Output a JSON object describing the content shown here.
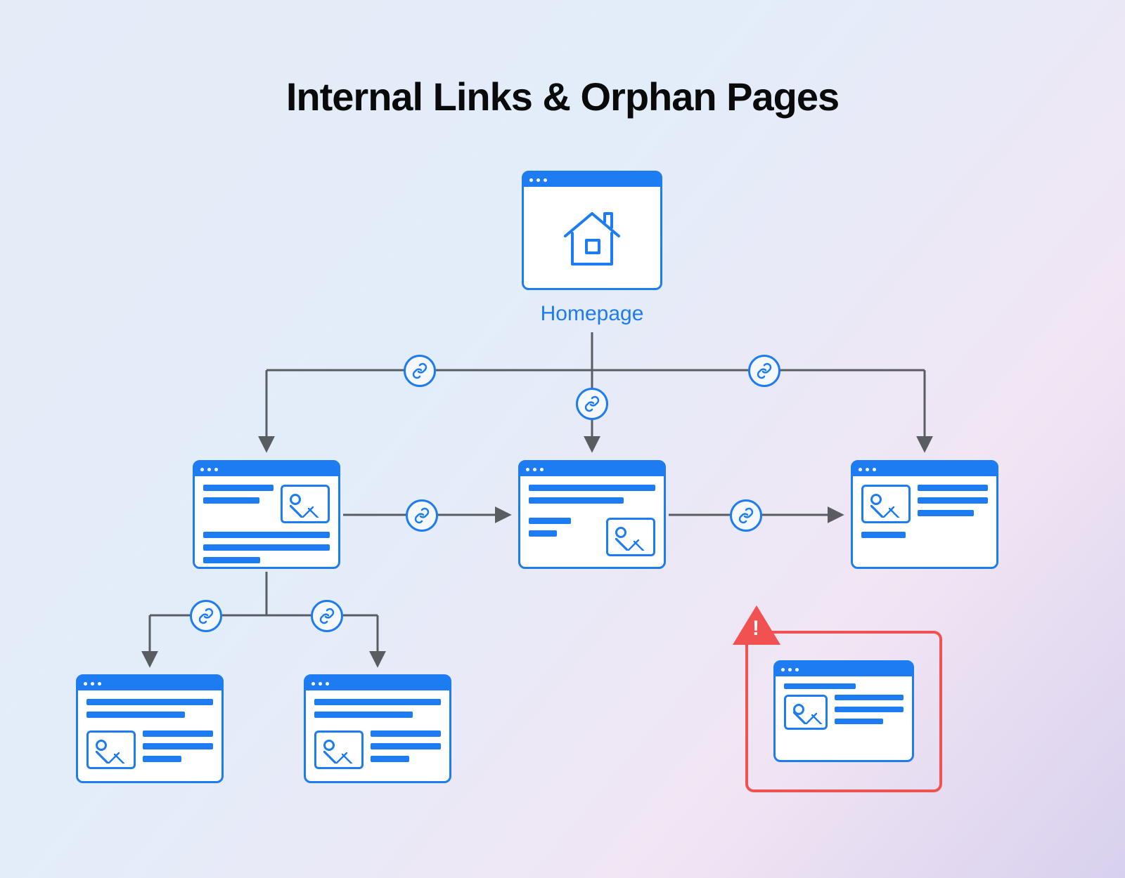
{
  "title": "Internal Links & Orphan Pages",
  "homepage_label": "Homepage",
  "nodes": {
    "homepage": {
      "type": "home"
    },
    "page_a": {
      "type": "content"
    },
    "page_b": {
      "type": "content"
    },
    "page_c": {
      "type": "content"
    },
    "page_d": {
      "type": "content"
    },
    "page_e": {
      "type": "content"
    },
    "orphan": {
      "type": "content",
      "orphaned": true
    }
  },
  "colors": {
    "primary": "#1d7cf2",
    "connector": "#595d62",
    "danger": "#f25151"
  }
}
